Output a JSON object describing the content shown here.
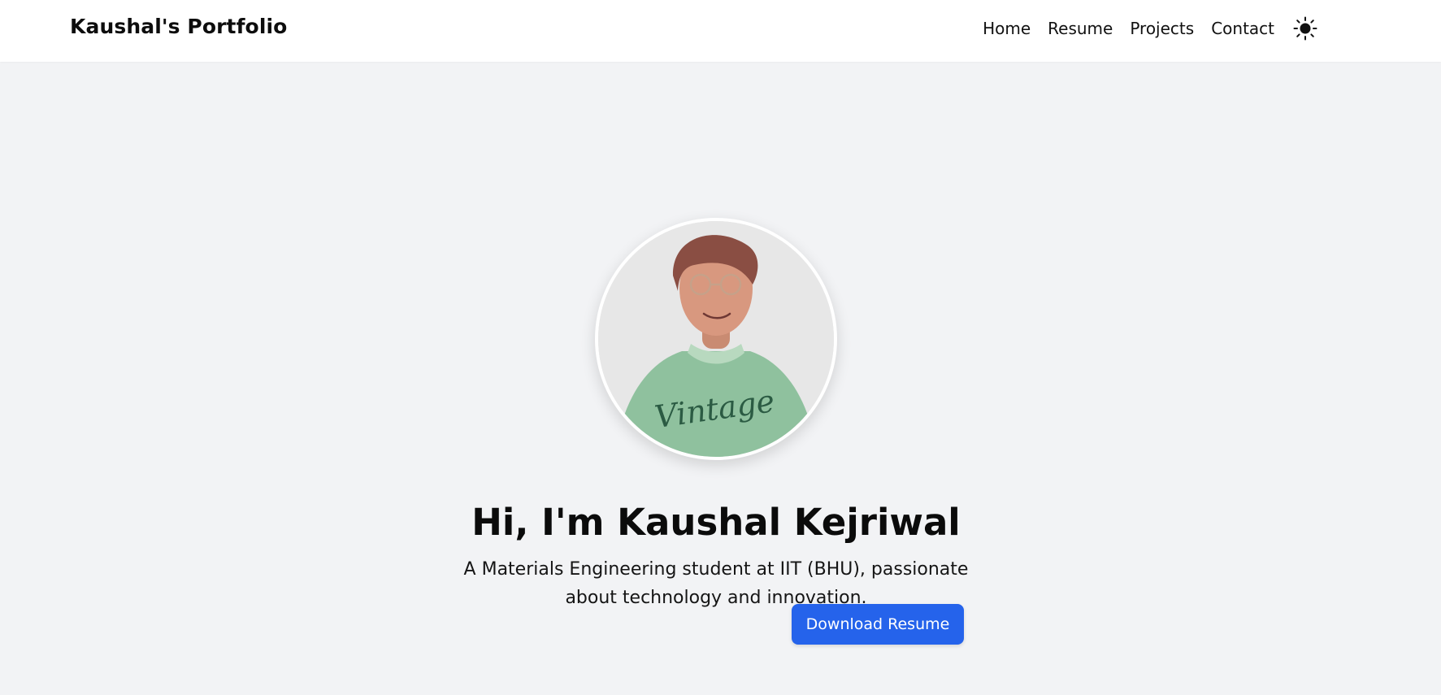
{
  "navbar": {
    "brand": "Kaushal's Portfolio",
    "links": [
      {
        "label": "Home"
      },
      {
        "label": "Resume"
      },
      {
        "label": "Projects"
      },
      {
        "label": "Contact"
      }
    ],
    "theme_toggle_icon": "sun-icon"
  },
  "hero": {
    "title": "Hi, I'm Kaushal Kejriwal",
    "subtitle": "A Materials Engineering student at IIT (BHU), passionate about technology and innovation.",
    "download_button_label": "Download Resume",
    "avatar_shirt_text": "Vintage",
    "avatar_icon": "profile-photo"
  },
  "colors": {
    "background": "#f2f3f5",
    "navbar": "#ffffff",
    "accent": "#2563eb",
    "shirt": "#8fc19e"
  }
}
